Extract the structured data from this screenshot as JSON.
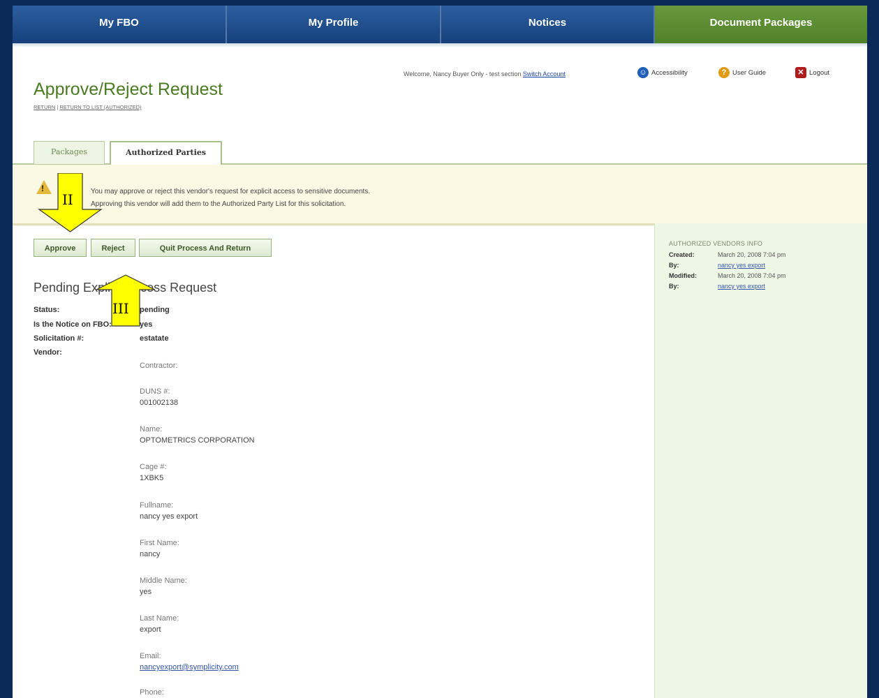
{
  "nav": {
    "tabs": [
      {
        "label": "My FBO"
      },
      {
        "label": "My Profile"
      },
      {
        "label": "Notices"
      },
      {
        "label": "Document Packages"
      }
    ]
  },
  "header": {
    "welcome_text": "Welcome, Nancy Buyer Only - test section",
    "switch_account": "Switch Account",
    "accessibility": "Accessibility",
    "user_guide": "User Guide",
    "logout": "Logout"
  },
  "page": {
    "title": "Approve/Reject Request",
    "crumb_return": "RETURN",
    "crumb_separator": "|",
    "crumb_return_list": "RETURN TO LIST (AUTHORIZED)"
  },
  "tabs": [
    {
      "label": "Packages"
    },
    {
      "label": "Authorized Parties"
    }
  ],
  "alert": {
    "line1": "You may approve or reject this vendor's request for explicit access to sensitive documents.",
    "line2": "Approving this vendor will add them to the Authorized Party List for this solicitation."
  },
  "buttons": {
    "approve": "Approve",
    "reject": "Reject",
    "quit": "Quit Process And Return"
  },
  "info_panel": {
    "title": "AUTHORIZED VENDORS INFO",
    "created_label": "Created:",
    "created_value": "March 20, 2008 7:04 pm",
    "by_label": "By:",
    "created_by": "nancy yes export",
    "modified_label": "Modified:",
    "modified_value": "March 20, 2008 7:04 pm",
    "modified_by": "nancy yes export"
  },
  "request": {
    "section_title": "Pending Explicit Access Request",
    "status_label": "Status:",
    "status_value": "pending",
    "notice_label": "Is the Notice on FBO:",
    "notice_value": "yes",
    "solicitation_label": "Solicitation #:",
    "solicitation_value": "estatate",
    "vendor_label": "Vendor:",
    "vendor": {
      "contractor_label": "Contractor:",
      "duns_label": "DUNS #:",
      "duns_value": "001002138",
      "name_label": "Name:",
      "name_value": "OPTOMETRICS CORPORATION",
      "cage_label": "Cage #:",
      "cage_value": "1XBK5",
      "fullname_label": "Fullname:",
      "fullname_value": "nancy yes export",
      "first_label": "First Name:",
      "first_value": "nancy",
      "middle_label": "Middle Name:",
      "middle_value": "yes",
      "last_label": "Last Name:",
      "last_value": "export",
      "email_label": "Email:",
      "email_value": "nancyexport@symplicity.com",
      "phone_label": "Phone:"
    }
  },
  "annotations": {
    "arrow_down_label": "II",
    "arrow_up_label": "III",
    "arrow_color": "#ffff00"
  }
}
